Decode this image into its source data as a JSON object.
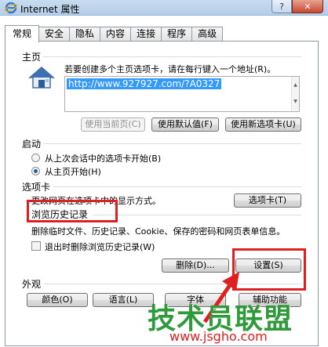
{
  "window": {
    "title": "Internet 属性",
    "help": "?",
    "close": "✕"
  },
  "tabs": [
    "常规",
    "安全",
    "隐私",
    "内容",
    "连接",
    "程序",
    "高级"
  ],
  "home": {
    "label": "主页",
    "hint": "若要创建多个主页选项卡，请在每行键入一个地址(R)。",
    "url": "http://www.927927.com/?A0327",
    "buttons": {
      "current": "使用当前页(C)",
      "default": "使用默认值(F)",
      "newtab": "使用新选项卡(U)"
    }
  },
  "startup": {
    "label": "启动",
    "options": [
      {
        "label": "从上次会话中的选项卡开始(B)",
        "checked": false
      },
      {
        "label": "从主页开始(H)",
        "checked": true
      }
    ]
  },
  "tabs_section": {
    "label": "选项卡",
    "hint": "更改网页在选项卡中的显示方式。",
    "button": "选项卡(T)"
  },
  "history": {
    "label": "浏览历史记录",
    "hint": "删除临时文件、历史记录、Cookie、保存的密码和网页表单信息。",
    "checkbox": "退出时删除浏览历史记录(W)",
    "delete_button": "删除(D)...",
    "settings_button": "设置(S)"
  },
  "appearance": {
    "label": "外观",
    "buttons": [
      "颜色(O)",
      "语言(L)",
      "字体",
      "辅助功能"
    ]
  },
  "watermark": {
    "title": "技术员联盟",
    "url": "www.jsgho.com"
  },
  "colors": {
    "annotation_red": "#e02020",
    "watermark_green": "#2e9a3a",
    "selection_blue": "#3399ff"
  }
}
